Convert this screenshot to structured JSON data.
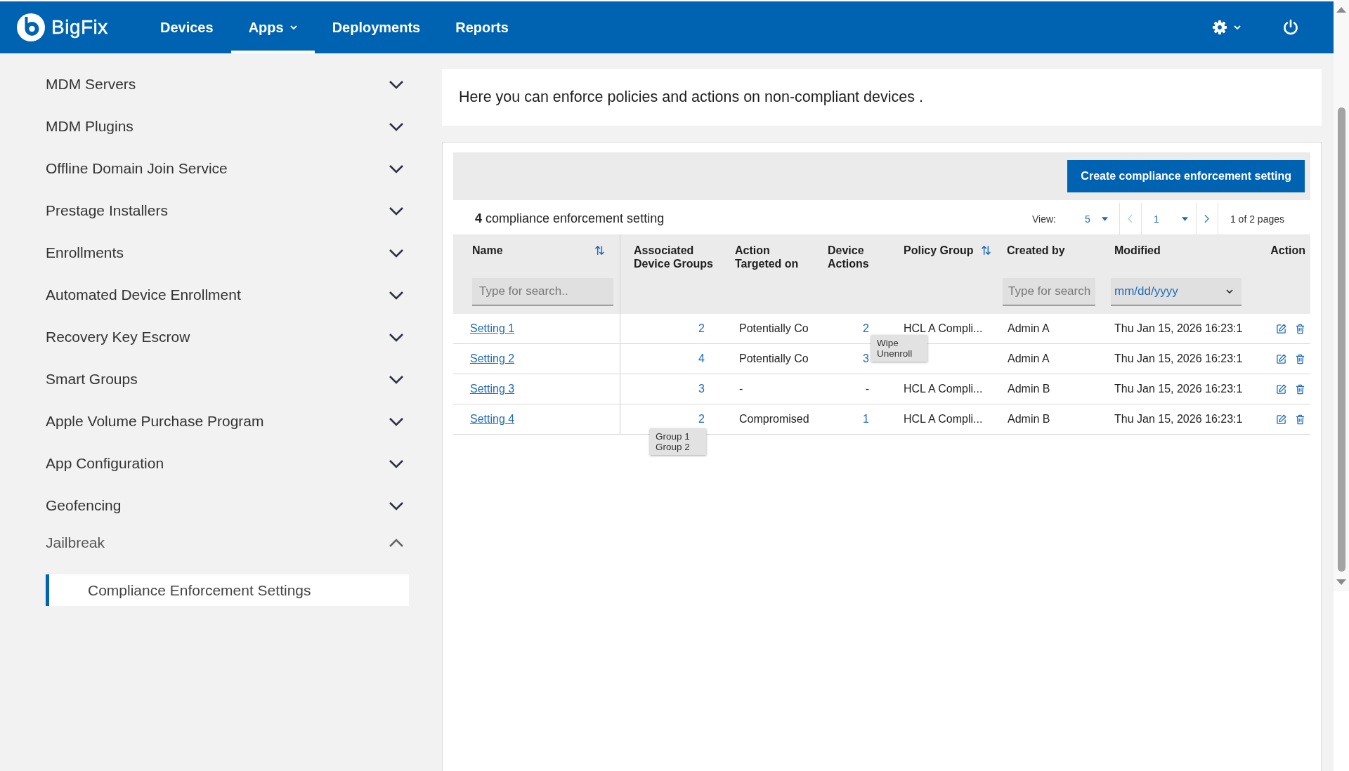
{
  "header": {
    "logo_text": "BigFix",
    "nav": [
      {
        "label": "Devices",
        "selected": false,
        "dropdown": false
      },
      {
        "label": "Apps",
        "selected": true,
        "dropdown": true
      },
      {
        "label": "Deployments",
        "selected": false,
        "dropdown": false
      },
      {
        "label": "Reports",
        "selected": false,
        "dropdown": false
      }
    ]
  },
  "sidebar": {
    "items": [
      {
        "label": "MDM Servers",
        "expanded": false
      },
      {
        "label": "MDM Plugins",
        "expanded": false
      },
      {
        "label": "Offline Domain Join Service",
        "expanded": false
      },
      {
        "label": "Prestage Installers",
        "expanded": false
      },
      {
        "label": "Enrollments",
        "expanded": false
      },
      {
        "label": "Automated Device Enrollment",
        "expanded": false
      },
      {
        "label": "Recovery Key Escrow",
        "expanded": false
      },
      {
        "label": "Smart Groups",
        "expanded": false
      },
      {
        "label": "Apple Volume Purchase Program",
        "expanded": false
      },
      {
        "label": "App Configuration",
        "expanded": false
      },
      {
        "label": "Geofencing",
        "expanded": false
      },
      {
        "label": "Jailbreak",
        "expanded": true,
        "children": [
          {
            "label": "Compliance Enforcement Settings",
            "selected": true
          }
        ]
      }
    ]
  },
  "banner": {
    "text": "Here you can enforce policies and actions on non-compliant devices ."
  },
  "toolbar": {
    "create_button": "Create compliance enforcement setting"
  },
  "summary": {
    "text": "**4** compliance enforcement setting"
  },
  "pager": {
    "view_label": "View:",
    "page_size": "5",
    "previous": {
      "disabled": true
    },
    "page": "1",
    "next": {
      "disabled": false
    },
    "page_info": "1 of 2 pages"
  },
  "table": {
    "columns": [
      {
        "label": "Name",
        "sortable": true,
        "filter": {
          "kind": "text",
          "placeholder": "Type for search.."
        }
      },
      {
        "label": "Associated Device Groups"
      },
      {
        "label": "Action Targeted on"
      },
      {
        "label": "Device Actions"
      },
      {
        "label": "Policy Group",
        "sortable": true
      },
      {
        "label": "Created by",
        "filter": {
          "kind": "text",
          "placeholder": "Type for search"
        }
      },
      {
        "label": "Modified",
        "filter": {
          "kind": "date",
          "placeholder": "mm/dd/yyyy"
        }
      },
      {
        "label": "Action"
      }
    ],
    "rows": [
      {
        "cells": [
          {
            "kind": "link",
            "text": "Setting 1"
          },
          {
            "kind": "count",
            "text": "2"
          },
          {
            "kind": "text",
            "text": "Potentially Co"
          },
          {
            "kind": "count",
            "text": "2",
            "tooltip": [
              "Wipe",
              "Unenroll"
            ]
          },
          {
            "kind": "text",
            "text": "HCL A Compli..."
          },
          {
            "kind": "text",
            "text": "Admin A"
          },
          {
            "kind": "text",
            "text": "Thu Jan 15, 2026 16:23:1"
          },
          {
            "kind": "actions"
          }
        ]
      },
      {
        "cells": [
          {
            "kind": "link",
            "text": "Setting 2"
          },
          {
            "kind": "count",
            "text": "4"
          },
          {
            "kind": "text",
            "text": "Potentially Co"
          },
          {
            "kind": "count",
            "text": "3"
          },
          null,
          {
            "kind": "text",
            "text": "Admin A"
          },
          {
            "kind": "text",
            "text": "Thu Jan 15, 2026 16:23:1"
          },
          {
            "kind": "actions"
          }
        ]
      },
      {
        "cells": [
          {
            "kind": "link",
            "text": "Setting 3"
          },
          {
            "kind": "count",
            "text": "3"
          },
          {
            "kind": "text",
            "text": "-"
          },
          {
            "kind": "text",
            "text": "-"
          },
          {
            "kind": "text",
            "text": "HCL A Compli..."
          },
          {
            "kind": "text",
            "text": "Admin B"
          },
          {
            "kind": "text",
            "text": "Thu Jan 15, 2026 16:23:1"
          },
          {
            "kind": "actions"
          }
        ]
      },
      {
        "cells": [
          {
            "kind": "link",
            "text": "Setting 4"
          },
          {
            "kind": "count",
            "text": "2",
            "tooltip": [
              "Group 1",
              "Group 2"
            ]
          },
          {
            "kind": "text",
            "text": "Compromised"
          },
          {
            "kind": "count",
            "text": "1"
          },
          {
            "kind": "text",
            "text": "HCL A Compli..."
          },
          {
            "kind": "text",
            "text": "Admin B"
          },
          {
            "kind": "text",
            "text": "Thu Jan 15, 2026 16:23:1"
          },
          {
            "kind": "actions"
          }
        ]
      }
    ]
  }
}
